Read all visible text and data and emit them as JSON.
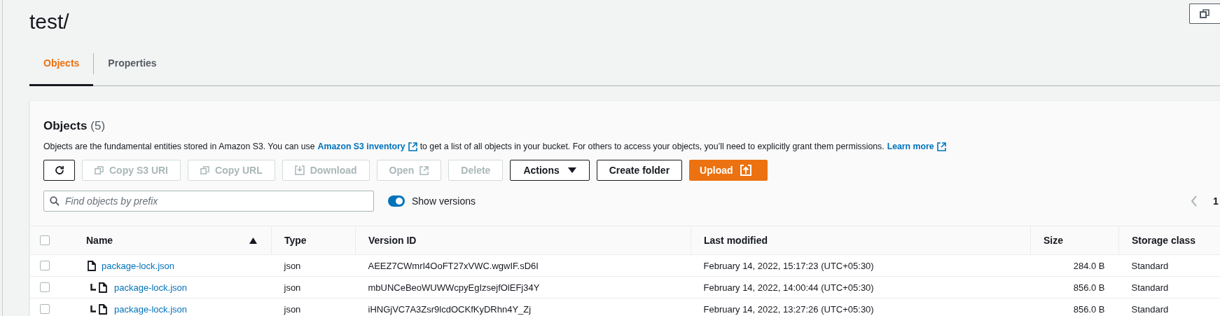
{
  "page": {
    "title": "test/"
  },
  "tabs": [
    {
      "label": "Objects",
      "selected": true
    },
    {
      "label": "Properties",
      "selected": false
    }
  ],
  "objects_panel": {
    "heading": "Objects",
    "count": "(5)",
    "description": {
      "before": "Objects are the fundamental entities stored in Amazon S3. You can use",
      "link": "Amazon S3 inventory",
      "middle": "to get a list of all objects in your bucket. For others to access your objects, you’ll need to explicitly grant them permissions.",
      "link2": "Learn more"
    },
    "buttons": [
      {
        "kind": "refresh",
        "disabled": false
      },
      {
        "kind": "copy",
        "label": "Copy S3 URI",
        "disabled": true
      },
      {
        "kind": "copy",
        "label": "Copy URL",
        "disabled": true
      },
      {
        "kind": "download",
        "label": "Download",
        "disabled": true
      },
      {
        "kind": "external",
        "label": "Open",
        "disabled": true
      },
      {
        "kind": "plain",
        "label": "Delete",
        "disabled": true
      },
      {
        "kind": "dropdown",
        "label": "Actions",
        "disabled": false
      },
      {
        "kind": "plain",
        "label": "Create folder",
        "disabled": false
      },
      {
        "kind": "primary",
        "label": "Upload",
        "disabled": false
      }
    ],
    "search": {
      "placeholder": "Find objects by prefix"
    },
    "show_versions": {
      "label": "Show versions",
      "on": true
    },
    "pagination": {
      "page": "1"
    }
  },
  "table": {
    "all_checked": false,
    "columns": [
      "Name",
      "Type",
      "Version ID",
      "Last modified",
      "Size",
      "Storage class"
    ],
    "rows": [
      {
        "checked": false,
        "name": "package-lock.json",
        "type": "json",
        "version_id": "AEEZ7CWmrI4OoFT27xVWC.wgwIF.sD6I",
        "last_modified": "February 14, 2022, 15:17:23 (UTC+05:30)",
        "size": "284.0 B",
        "storage_class": "Standard",
        "children": [
          {
            "checked": false,
            "name": "package-lock.json",
            "type": "json",
            "version_id": "mbUNCeBeoWUWWcpyEgIzsejfOlEFj34Y",
            "last_modified": "February 14, 2022, 14:00:44 (UTC+05:30)",
            "size": "856.0 B",
            "storage_class": "Standard"
          },
          {
            "checked": false,
            "name": "package-lock.json",
            "type": "json",
            "version_id": "iHNGjVC7A3Zsr9lcdOCKfKyDRhn4Y_Zj",
            "last_modified": "February 14, 2022, 13:27:26 (UTC+05:30)",
            "size": "856.0 B",
            "storage_class": "Standard"
          }
        ]
      }
    ]
  }
}
